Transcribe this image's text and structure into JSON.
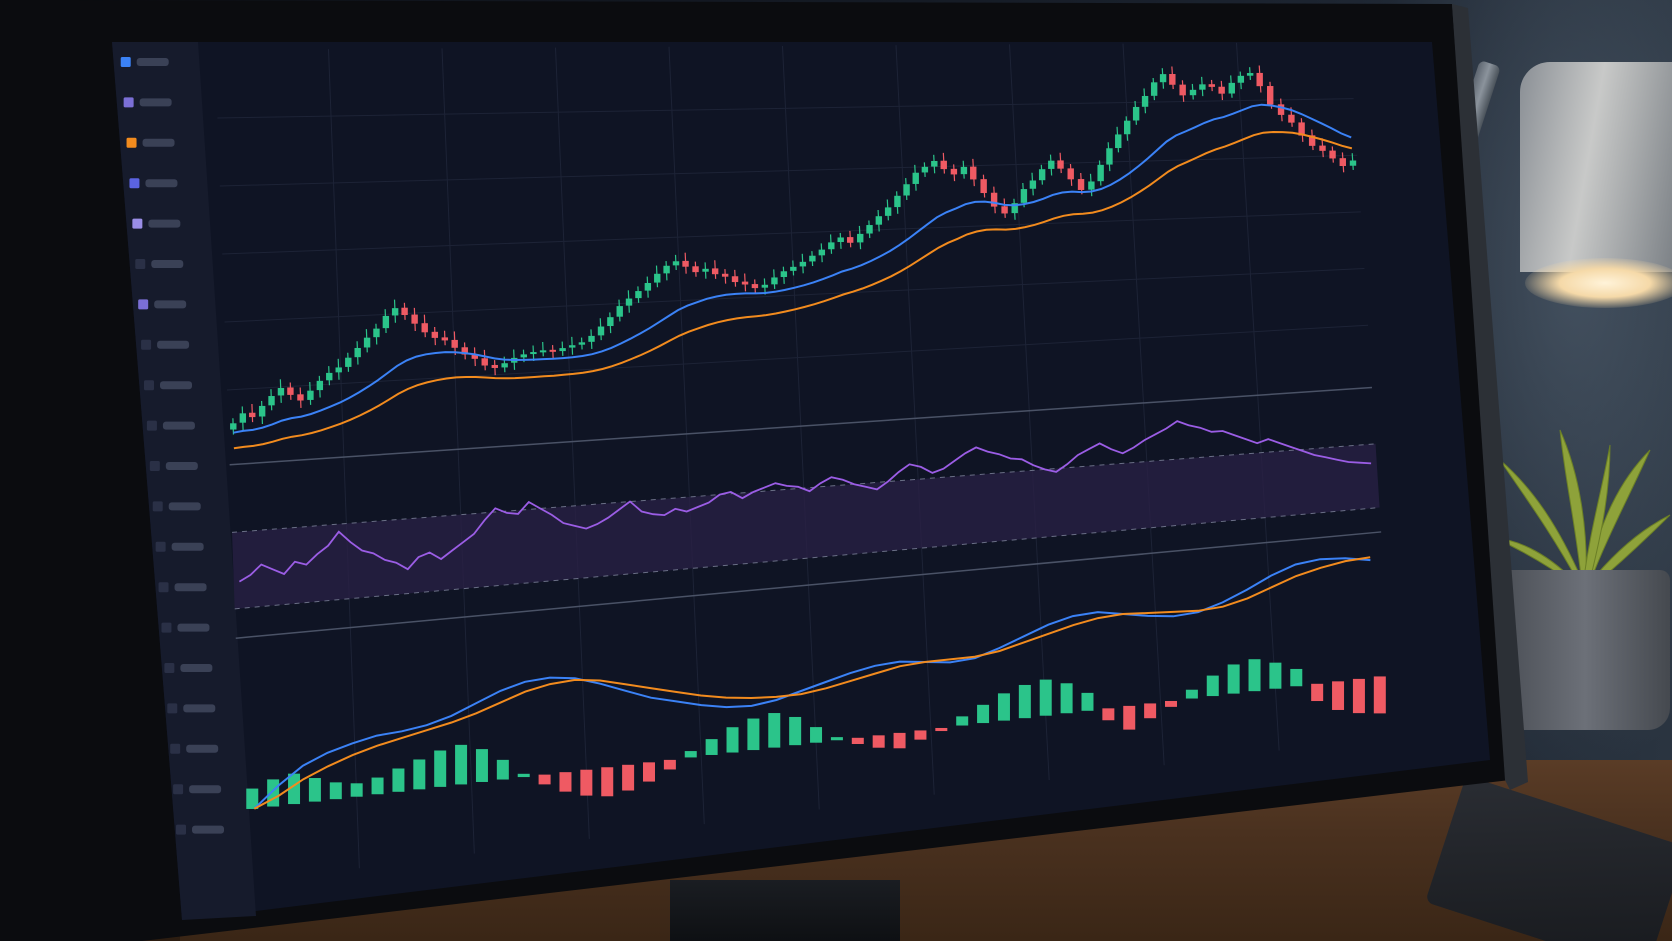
{
  "colors": {
    "background": "#0f1424",
    "grid": "#1d2336",
    "candle_up": "#2bc48a",
    "candle_down": "#ef5a63",
    "ema_fast": "#3b82f6",
    "ema_slow": "#f28b1e",
    "oscillator": "#9b5de5",
    "oscillator_band": "#2a2046",
    "macd_line": "#3b82f6",
    "signal_line": "#f28b1e",
    "hist_up": "#2bc48a",
    "hist_down": "#ef5a63"
  },
  "toolbar": {
    "icons": [
      {
        "name": "tool-1-icon",
        "color": "#3b82f6"
      },
      {
        "name": "tool-2-icon",
        "color": "#7b6fd6"
      },
      {
        "name": "tool-3-icon",
        "color": "#f28b1e"
      },
      {
        "name": "tool-4-icon",
        "color": "#5b63e0"
      },
      {
        "name": "tool-5-icon",
        "color": "#9a8ee6"
      },
      {
        "name": "tool-6-icon",
        "color": "#2a3046"
      },
      {
        "name": "tool-7-icon",
        "color": "#7b6fd6"
      },
      {
        "name": "tool-8-icon",
        "color": "#2a3046"
      },
      {
        "name": "tool-9-icon",
        "color": "#2a3046"
      },
      {
        "name": "tool-10-icon",
        "color": "#2a3046"
      },
      {
        "name": "tool-11-icon",
        "color": "#2a3046"
      },
      {
        "name": "tool-12-icon",
        "color": "#2a3046"
      },
      {
        "name": "tool-13-icon",
        "color": "#2a3046"
      },
      {
        "name": "tool-14-icon",
        "color": "#2a3046"
      },
      {
        "name": "tool-15-icon",
        "color": "#2a3046"
      },
      {
        "name": "tool-16-icon",
        "color": "#2a3046"
      },
      {
        "name": "tool-17-icon",
        "color": "#2a3046"
      },
      {
        "name": "tool-18-icon",
        "color": "#2a3046"
      },
      {
        "name": "tool-19-icon",
        "color": "#2a3046"
      },
      {
        "name": "tool-20-icon",
        "color": "#2a3046"
      }
    ]
  },
  "chart_data": [
    {
      "type": "candlestick",
      "title": "",
      "candles_close": [
        100,
        101.5,
        100.8,
        102.5,
        104,
        105.2,
        104,
        103,
        104.5,
        106,
        107.2,
        108,
        109.5,
        111,
        112.6,
        114,
        116,
        117.2,
        116,
        114.5,
        113,
        112,
        111.5,
        110.2,
        109,
        108.2,
        107,
        106.5,
        107.2,
        108,
        108.5,
        108.8,
        109,
        108.7,
        109.2,
        109.6,
        110,
        111,
        112.5,
        114,
        115.8,
        117,
        118.2,
        119.5,
        121,
        122.3,
        123,
        122,
        121,
        121.5,
        120.5,
        120,
        119,
        118.5,
        117.8,
        118.3,
        119.5,
        120.5,
        121.2,
        122,
        123,
        124,
        125.2,
        126,
        125,
        126.5,
        128,
        129.5,
        131,
        133,
        135,
        137,
        138,
        139,
        137.5,
        136.5,
        137.8,
        135.5,
        133,
        130.5,
        129.2,
        131,
        133.5,
        135,
        137,
        138.5,
        137,
        135,
        133,
        134.5,
        137.5,
        140.5,
        143,
        145.5,
        148,
        150,
        152.5,
        154,
        152,
        150,
        151,
        152,
        151.5,
        150.2,
        152.2,
        153.5,
        154,
        151.5,
        148,
        146,
        144.5,
        142,
        140,
        139,
        137.5,
        136,
        137
      ],
      "ema_fast_visible": true,
      "ema_slow_visible": true,
      "grid": true
    },
    {
      "type": "line",
      "title": "",
      "series": [
        {
          "values": [
            44,
            47,
            52,
            49,
            46,
            52,
            50,
            55,
            59,
            66,
            60,
            55,
            53,
            49,
            47,
            43,
            49,
            51,
            47,
            51,
            55,
            59,
            66,
            72,
            69,
            68,
            74,
            70,
            66,
            61,
            59,
            57,
            59,
            62,
            66,
            70,
            64,
            62,
            61,
            64,
            62,
            64,
            66,
            70,
            71,
            67,
            70,
            72,
            74,
            72,
            71,
            68,
            72,
            75,
            73,
            70,
            68,
            66,
            70,
            75,
            79,
            77,
            73,
            75,
            79,
            83,
            86,
            83,
            81,
            78,
            77,
            73,
            70,
            68,
            72,
            77,
            80,
            83,
            79,
            76,
            79,
            83,
            86,
            89,
            93,
            90,
            88,
            85,
            85,
            82,
            79,
            76,
            78,
            75,
            72,
            69,
            66,
            64,
            62,
            60,
            59,
            58
          ]
        }
      ],
      "band": [
        30,
        70
      ],
      "grid": false
    },
    {
      "type": "line+bar",
      "title": "",
      "series": [
        {
          "values": [
            0,
            0.6,
            1.1,
            1.4,
            1.6,
            1.75,
            1.8,
            1.9,
            2.1,
            2.4,
            2.7,
            2.9,
            2.95,
            2.85,
            2.6,
            2.3,
            2.0,
            1.8,
            1.6,
            1.45,
            1.4,
            1.5,
            1.7,
            1.9,
            2.1,
            2.25,
            2.3,
            2.2,
            2.1,
            2.15,
            2.4,
            2.7,
            3.0,
            3.2,
            3.25,
            3.1,
            2.95,
            2.85,
            2.9,
            3.15,
            3.5,
            3.9,
            4.2,
            4.3,
            4.25,
            4.1
          ]
        },
        {
          "values": [
            0,
            0.3,
            0.7,
            1.0,
            1.25,
            1.45,
            1.6,
            1.75,
            1.9,
            2.1,
            2.35,
            2.6,
            2.75,
            2.8,
            2.7,
            2.5,
            2.3,
            2.1,
            1.9,
            1.75,
            1.65,
            1.6,
            1.6,
            1.7,
            1.85,
            2.0,
            2.15,
            2.2,
            2.2,
            2.2,
            2.3,
            2.5,
            2.7,
            2.9,
            3.05,
            3.1,
            3.05,
            3.0,
            2.95,
            3.0,
            3.2,
            3.5,
            3.8,
            4.0,
            4.15,
            4.2
          ]
        }
      ],
      "histogram": [
        0.6,
        0.8,
        0.9,
        0.7,
        0.5,
        0.4,
        0.5,
        0.7,
        0.9,
        1.1,
        1.2,
        1.0,
        0.6,
        0.1,
        -0.3,
        -0.6,
        -0.8,
        -0.9,
        -0.8,
        -0.6,
        -0.3,
        0.2,
        0.5,
        0.8,
        1.0,
        1.1,
        0.9,
        0.5,
        0.1,
        -0.2,
        -0.4,
        -0.5,
        -0.3,
        -0.1,
        0.3,
        0.6,
        0.9,
        1.1,
        1.2,
        1.0,
        0.6,
        -0.4,
        -0.8,
        -0.5,
        -0.2,
        0.3,
        0.7,
        1.0,
        1.1,
        0.9,
        0.6,
        -0.6,
        -1.0,
        -1.2,
        -1.3
      ],
      "grid": false
    }
  ]
}
